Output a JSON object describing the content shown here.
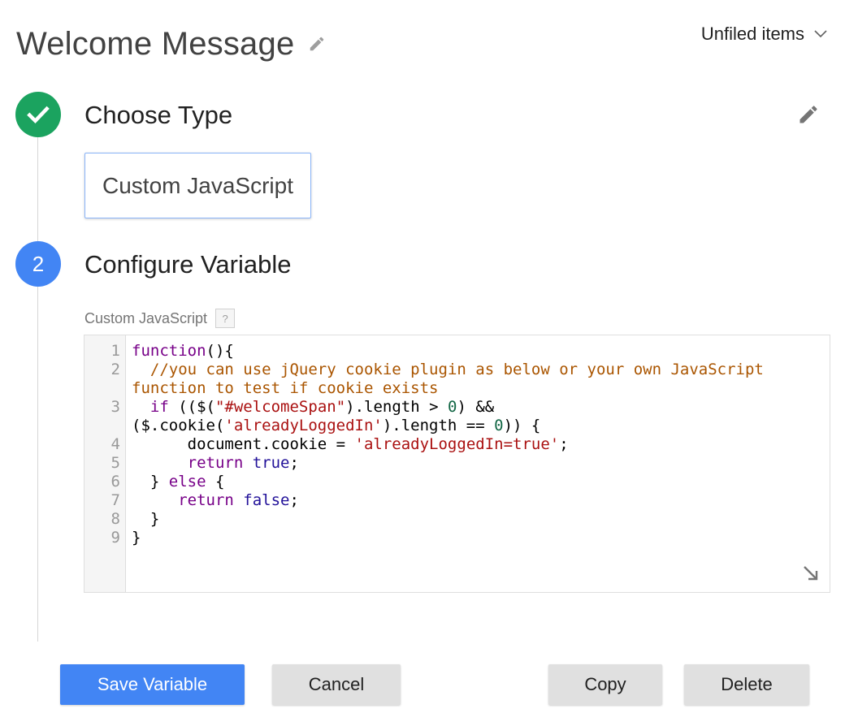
{
  "header": {
    "title": "Welcome Message",
    "folder_label": "Unfiled items",
    "title_edit_icon": "pencil-icon",
    "folder_chevron_icon": "chevron-down-icon"
  },
  "step1": {
    "badge_icon": "checkmark-icon",
    "title": "Choose Type",
    "edit_icon": "pencil-icon",
    "selected_type": "Custom JavaScript"
  },
  "step2": {
    "badge_number": "2",
    "title": "Configure Variable",
    "field_label": "Custom JavaScript",
    "help_glyph": "?"
  },
  "editor": {
    "line_numbers": [
      "1",
      "2",
      "",
      "3",
      "",
      "4",
      "5",
      "6",
      "7",
      "8",
      "9"
    ],
    "code_text": "function(){\n  //you can use jQuery cookie plugin as below or your own JavaScript function to test if cookie exists\n  if (($(\"#welcomeSpan\").length > 0) && ($.cookie('alreadyLoggedIn').length == 0)) {\n      document.cookie = 'alreadyLoggedIn=true';\n      return true;\n  } else {\n     return false;\n  }\n}",
    "resize_icon": "resize-arrow-icon"
  },
  "buttons": {
    "save": "Save Variable",
    "cancel": "Cancel",
    "copy": "Copy",
    "delete": "Delete"
  },
  "colors": {
    "success": "#1ba35f",
    "primary": "#4285f4",
    "secondary_button": "#e0e0e0"
  }
}
